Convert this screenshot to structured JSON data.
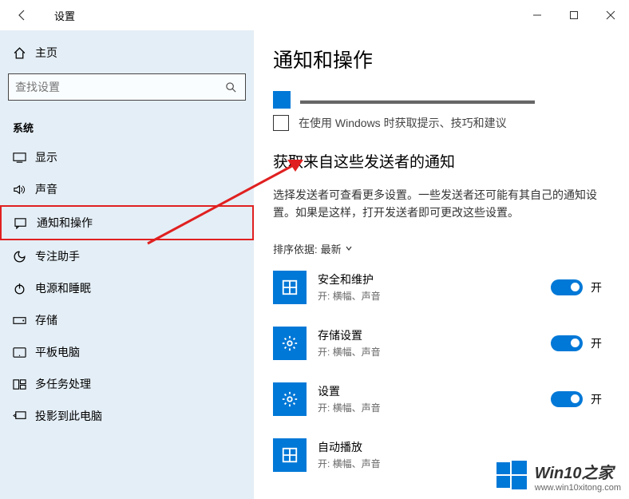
{
  "titlebar": {
    "title": "设置"
  },
  "sidebar": {
    "search_placeholder": "查找设置",
    "home_label": "主页",
    "section_label": "系统",
    "items": [
      {
        "label": "显示"
      },
      {
        "label": "声音"
      },
      {
        "label": "通知和操作"
      },
      {
        "label": "专注助手"
      },
      {
        "label": "电源和睡眠"
      },
      {
        "label": "存储"
      },
      {
        "label": "平板电脑"
      },
      {
        "label": "多任务处理"
      },
      {
        "label": "投影到此电脑"
      }
    ]
  },
  "main": {
    "page_title": "通知和操作",
    "checkbox2_label": "在使用 Windows 时获取提示、技巧和建议",
    "section_title": "获取来自这些发送者的通知",
    "section_desc": "选择发送者可查看更多设置。一些发送者还可能有其自己的通知设置。如果是这样，打开发送者即可更改这些设置。",
    "sort_label": "排序依据:",
    "sort_value": "最新",
    "toggle_on_label": "开",
    "senders": [
      {
        "name": "安全和维护",
        "sub": "开: 横幅、声音"
      },
      {
        "name": "存储设置",
        "sub": "开: 横幅、声音"
      },
      {
        "name": "设置",
        "sub": "开: 横幅、声音"
      },
      {
        "name": "自动播放",
        "sub": "开: 横幅、声音"
      }
    ]
  },
  "watermark": {
    "title": "Win10之家",
    "url": "www.win10xitong.com"
  }
}
